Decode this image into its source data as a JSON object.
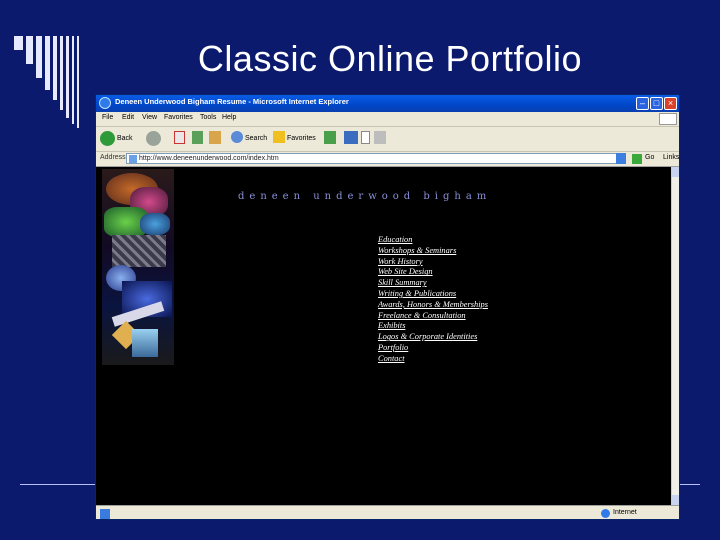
{
  "slide": {
    "title": "Classic Online Portfolio",
    "colors": {
      "background": "#0c1a6e",
      "title": "#ffffff",
      "accent_bars": "#e6e9ff"
    }
  },
  "browser": {
    "window_title": "Deneen Underwood Bigham Resume - Microsoft Internet Explorer",
    "menu": [
      "File",
      "Edit",
      "View",
      "Favorites",
      "Tools",
      "Help"
    ],
    "toolbar": {
      "back": "Back",
      "search": "Search",
      "favorites": "Favorites"
    },
    "address": {
      "label": "Address",
      "url": "http://www.deneenunderwood.com/index.htm",
      "go": "Go",
      "links": "Links"
    },
    "status": {
      "zone": "Internet"
    }
  },
  "page": {
    "site_name": "deneen underwood bigham",
    "nav": [
      "Education",
      "Workshops & Seminars",
      "Work History",
      "Web Site Design",
      "Skill Summary",
      "Writing & Publications",
      "Awards, Honors & Memberships",
      "Freelance & Consultation",
      "Exhibits",
      "Logos & Corporate Identities",
      "Portfolio",
      "Contact"
    ]
  }
}
